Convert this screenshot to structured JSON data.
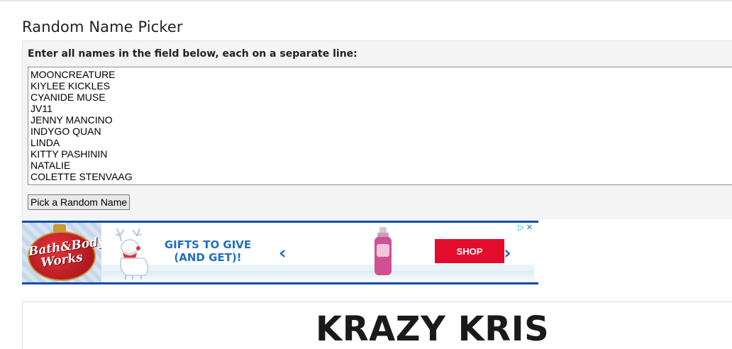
{
  "page": {
    "title": "Random Name Picker"
  },
  "form": {
    "instructions": "Enter all names in the field below, each on a separate line:",
    "names": [
      "MOONCREATURE",
      "KIYLEE KICKLES",
      "CYANIDE MUSE",
      "JV11",
      "JENNY MANCINO",
      "INDYGO QUAN",
      "LINDA",
      "KITTY PASHININ",
      "NATALIE",
      "COLETTE STENVAAG"
    ],
    "pick_button_label": "Pick a Random Name"
  },
  "ad": {
    "brand_text": "Bath&Body Works",
    "headline": "GIFTS TO GIVE (AND GET)!",
    "prev_icon": "chevron-left-icon",
    "next_icon": "chevron-right-icon",
    "shop_label": "SHOP",
    "adchoices_icon": "adchoices-play-icon",
    "close_icon": "close-icon",
    "colors": {
      "border": "#0a4da2",
      "headline": "#1e6fc0",
      "shop_button": "#e40c2c"
    }
  },
  "result": {
    "picked_name": "KRAZY KRIS"
  }
}
